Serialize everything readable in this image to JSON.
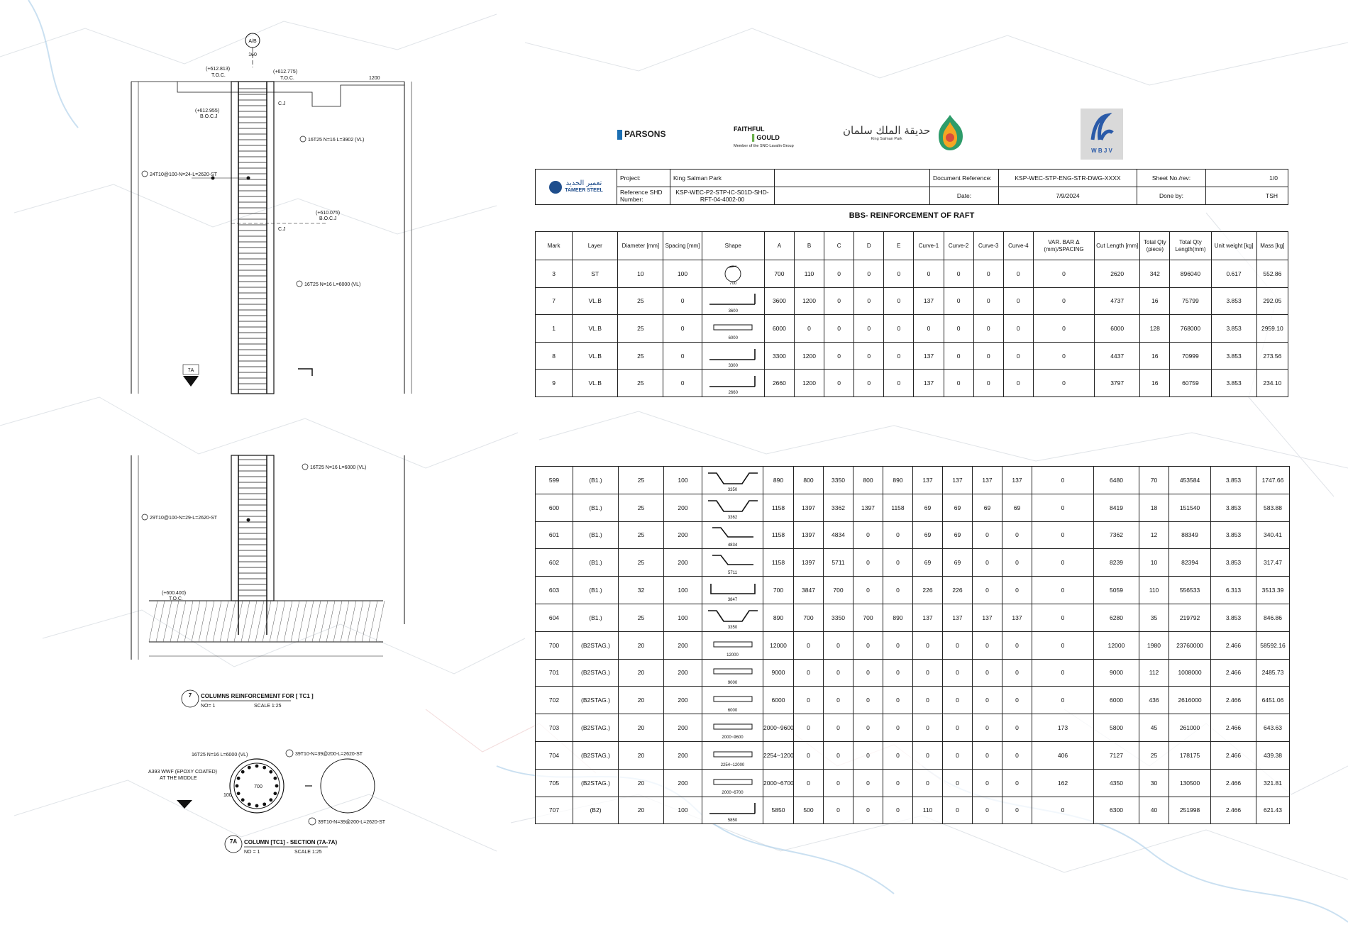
{
  "logos": {
    "parsons": "PARSONS",
    "faithful_line1": "FAITHFUL",
    "faithful_line2": "GOULD",
    "faithful_sub": "Member of the SNC-Lavalin Group",
    "ksp_arabic": "حديقة الملك سلمان",
    "ksp_sub": "King Salman Park",
    "wbjv": "W B J V",
    "tameer_ar": "تعمير الحديد",
    "tameer_en": "TAMEER STEEL"
  },
  "header": {
    "project_label": "Project:",
    "project_value": "King Salman Park",
    "doc_ref_label": "Document Reference:",
    "doc_ref_value": "KSP-WEC-STP-ENG-STR-DWG-XXXX",
    "sheet_label": "Sheet No./rev:",
    "sheet_value": "1/0",
    "ref_shd_label": "Reference SHD Number:",
    "ref_shd_value": "KSP-WEC-P2-STP-IC-S01D-SHD-RFT-04-4002-00",
    "date_label": "Date:",
    "date_value": "7/9/2024",
    "done_label": "Done by:",
    "done_value": "TSH"
  },
  "title": "BBS- REINFORCEMENT OF RAFT",
  "columns": [
    "Mark",
    "Layer",
    "Diameter [mm]",
    "Spacing [mm]",
    "Shape",
    "A",
    "B",
    "C",
    "D",
    "E",
    "Curve-1",
    "Curve-2",
    "Curve-3",
    "Curve-4",
    "VAR. BAR Δ (mm)/SPACING",
    "Cut Length [mm]",
    "Total Qty (piece)",
    "Total Qty Length(mm)",
    "Unit weight [kg]",
    "Mass [kg]"
  ],
  "rows_top": [
    {
      "mark": "3",
      "layer": "ST",
      "dia": "10",
      "sp": "100",
      "shape": "circle",
      "shape_text": "700",
      "A": "700",
      "B": "110",
      "C": "0",
      "D": "0",
      "E": "0",
      "c1": "0",
      "c2": "0",
      "c3": "0",
      "c4": "0",
      "var": "0",
      "cut": "2620",
      "qty": "342",
      "len": "896040",
      "uw": "0.617",
      "mass": "552.86"
    },
    {
      "mark": "7",
      "layer": "VL.B",
      "dia": "25",
      "sp": "0",
      "shape": "L",
      "shape_text": "3600",
      "A": "3600",
      "B": "1200",
      "C": "0",
      "D": "0",
      "E": "0",
      "c1": "137",
      "c2": "0",
      "c3": "0",
      "c4": "0",
      "var": "0",
      "cut": "4737",
      "qty": "16",
      "len": "75799",
      "uw": "3.853",
      "mass": "292.05"
    },
    {
      "mark": "1",
      "layer": "VL.B",
      "dia": "25",
      "sp": "0",
      "shape": "bar",
      "shape_text": "6000",
      "A": "6000",
      "B": "0",
      "C": "0",
      "D": "0",
      "E": "0",
      "c1": "0",
      "c2": "0",
      "c3": "0",
      "c4": "0",
      "var": "0",
      "cut": "6000",
      "qty": "128",
      "len": "768000",
      "uw": "3.853",
      "mass": "2959.10"
    },
    {
      "mark": "8",
      "layer": "VL.B",
      "dia": "25",
      "sp": "0",
      "shape": "L",
      "shape_text": "3300",
      "A": "3300",
      "B": "1200",
      "C": "0",
      "D": "0",
      "E": "0",
      "c1": "137",
      "c2": "0",
      "c3": "0",
      "c4": "0",
      "var": "0",
      "cut": "4437",
      "qty": "16",
      "len": "70999",
      "uw": "3.853",
      "mass": "273.56"
    },
    {
      "mark": "9",
      "layer": "VL.B",
      "dia": "25",
      "sp": "0",
      "shape": "L",
      "shape_text": "2660",
      "A": "2660",
      "B": "1200",
      "C": "0",
      "D": "0",
      "E": "0",
      "c1": "137",
      "c2": "0",
      "c3": "0",
      "c4": "0",
      "var": "0",
      "cut": "3797",
      "qty": "16",
      "len": "60759",
      "uw": "3.853",
      "mass": "234.10"
    }
  ],
  "rows_bottom": [
    {
      "mark": "599",
      "layer": "(B1.)",
      "dia": "25",
      "sp": "100",
      "shape": "crank2",
      "shape_text": "3350",
      "A": "890",
      "B": "800",
      "C": "3350",
      "D": "800",
      "E": "890",
      "c1": "137",
      "c2": "137",
      "c3": "137",
      "c4": "137",
      "var": "0",
      "cut": "6480",
      "qty": "70",
      "len": "453584",
      "uw": "3.853",
      "mass": "1747.66"
    },
    {
      "mark": "600",
      "layer": "(B1.)",
      "dia": "25",
      "sp": "200",
      "shape": "crank2",
      "shape_text": "3362",
      "A": "1158",
      "B": "1397",
      "C": "3362",
      "D": "1397",
      "E": "1158",
      "c1": "69",
      "c2": "69",
      "c3": "69",
      "c4": "69",
      "var": "0",
      "cut": "8419",
      "qty": "18",
      "len": "151540",
      "uw": "3.853",
      "mass": "583.88"
    },
    {
      "mark": "601",
      "layer": "(B1.)",
      "dia": "25",
      "sp": "200",
      "shape": "crank1",
      "shape_text": "4834",
      "A": "1158",
      "B": "1397",
      "C": "4834",
      "D": "0",
      "E": "0",
      "c1": "69",
      "c2": "69",
      "c3": "0",
      "c4": "0",
      "var": "0",
      "cut": "7362",
      "qty": "12",
      "len": "88349",
      "uw": "3.853",
      "mass": "340.41"
    },
    {
      "mark": "602",
      "layer": "(B1.)",
      "dia": "25",
      "sp": "200",
      "shape": "crank1",
      "shape_text": "5711",
      "A": "1158",
      "B": "1397",
      "C": "5711",
      "D": "0",
      "E": "0",
      "c1": "69",
      "c2": "69",
      "c3": "0",
      "c4": "0",
      "var": "0",
      "cut": "8239",
      "qty": "10",
      "len": "82394",
      "uw": "3.853",
      "mass": "317.47"
    },
    {
      "mark": "603",
      "layer": "(B1.)",
      "dia": "32",
      "sp": "100",
      "shape": "U",
      "shape_text": "3847",
      "A": "700",
      "B": "3847",
      "C": "700",
      "D": "0",
      "E": "0",
      "c1": "226",
      "c2": "226",
      "c3": "0",
      "c4": "0",
      "var": "0",
      "cut": "5059",
      "qty": "110",
      "len": "556533",
      "uw": "6.313",
      "mass": "3513.39"
    },
    {
      "mark": "604",
      "layer": "(B1.)",
      "dia": "25",
      "sp": "100",
      "shape": "crank2",
      "shape_text": "3350",
      "A": "890",
      "B": "700",
      "C": "3350",
      "D": "700",
      "E": "890",
      "c1": "137",
      "c2": "137",
      "c3": "137",
      "c4": "137",
      "var": "0",
      "cut": "6280",
      "qty": "35",
      "len": "219792",
      "uw": "3.853",
      "mass": "846.86"
    },
    {
      "mark": "700",
      "layer": "(B2STAG.)",
      "dia": "20",
      "sp": "200",
      "shape": "bar",
      "shape_text": "12000",
      "A": "12000",
      "B": "0",
      "C": "0",
      "D": "0",
      "E": "0",
      "c1": "0",
      "c2": "0",
      "c3": "0",
      "c4": "0",
      "var": "0",
      "cut": "12000",
      "qty": "1980",
      "len": "23760000",
      "uw": "2.466",
      "mass": "58592.16"
    },
    {
      "mark": "701",
      "layer": "(B2STAG.)",
      "dia": "20",
      "sp": "200",
      "shape": "bar",
      "shape_text": "9000",
      "A": "9000",
      "B": "0",
      "C": "0",
      "D": "0",
      "E": "0",
      "c1": "0",
      "c2": "0",
      "c3": "0",
      "c4": "0",
      "var": "0",
      "cut": "9000",
      "qty": "112",
      "len": "1008000",
      "uw": "2.466",
      "mass": "2485.73"
    },
    {
      "mark": "702",
      "layer": "(B2STAG.)",
      "dia": "20",
      "sp": "200",
      "shape": "bar",
      "shape_text": "6000",
      "A": "6000",
      "B": "0",
      "C": "0",
      "D": "0",
      "E": "0",
      "c1": "0",
      "c2": "0",
      "c3": "0",
      "c4": "0",
      "var": "0",
      "cut": "6000",
      "qty": "436",
      "len": "2616000",
      "uw": "2.466",
      "mass": "6451.06"
    },
    {
      "mark": "703",
      "layer": "(B2STAG.)",
      "dia": "20",
      "sp": "200",
      "shape": "bar",
      "shape_text": "2000~9600",
      "A": "2000~9600",
      "B": "0",
      "C": "0",
      "D": "0",
      "E": "0",
      "c1": "0",
      "c2": "0",
      "c3": "0",
      "c4": "0",
      "var": "173",
      "cut": "5800",
      "qty": "45",
      "len": "261000",
      "uw": "2.466",
      "mass": "643.63"
    },
    {
      "mark": "704",
      "layer": "(B2STAG.)",
      "dia": "20",
      "sp": "200",
      "shape": "bar",
      "shape_text": "2254~12000",
      "A": "2254~12000",
      "B": "0",
      "C": "0",
      "D": "0",
      "E": "0",
      "c1": "0",
      "c2": "0",
      "c3": "0",
      "c4": "0",
      "var": "406",
      "cut": "7127",
      "qty": "25",
      "len": "178175",
      "uw": "2.466",
      "mass": "439.38"
    },
    {
      "mark": "705",
      "layer": "(B2STAG.)",
      "dia": "20",
      "sp": "200",
      "shape": "bar",
      "shape_text": "2000~6700",
      "A": "2000~6700",
      "B": "0",
      "C": "0",
      "D": "0",
      "E": "0",
      "c1": "0",
      "c2": "0",
      "c3": "0",
      "c4": "0",
      "var": "162",
      "cut": "4350",
      "qty": "30",
      "len": "130500",
      "uw": "2.466",
      "mass": "321.81"
    },
    {
      "mark": "707",
      "layer": "(B2)",
      "dia": "20",
      "sp": "100",
      "shape": "L",
      "shape_text": "5850",
      "A": "5850",
      "B": "500",
      "C": "0",
      "D": "0",
      "E": "0",
      "c1": "110",
      "c2": "0",
      "c3": "0",
      "c4": "0",
      "var": "0",
      "cut": "6300",
      "qty": "40",
      "len": "251998",
      "uw": "2.466",
      "mass": "621.43"
    }
  ],
  "drawing": {
    "grid_label": "A/B",
    "dim_160": "160",
    "dim_1200": "1200",
    "lvl_1": "(+612.813)",
    "lvl_1_sub": "T.O.C.",
    "lvl_2": "(+612.775)",
    "lvl_2_sub": "T.O.C.",
    "lvl_3": "(+612.955)",
    "lvl_3_sub": "B.O.C.J",
    "lvl_4": "(+610.075)",
    "lvl_4_sub": "B.O.C.J",
    "lvl_5": "(+600.400)",
    "lvl_5_sub": "T.O.C.",
    "cj": "C.J",
    "call_5": "16T25 N=16 L=3902 (VL)",
    "call_1": "16T25 N=16 L=6000 (VL)",
    "call_3a": "24T10@100-N=24-L=2620-ST",
    "call_3b": "29T10@100-N=29-L=2620-ST",
    "call_1b": "16T25 N=16 L=6000 (VL)",
    "sec_mark": "7A",
    "detail_no": "7",
    "detail_title": "COLUMNS REINFORCEMENT FOR [ TC1 ]",
    "detail_no_sub": "NO= 1",
    "detail_scale": "SCALE 1:25",
    "sec_no": "7A",
    "sec_title": "COLUMN [TC1] - SECTION (7A-7A)",
    "sec_no_sub": "NO = 1",
    "sec_scale": "SCALE 1:25",
    "s_call1": "16T25 N=16 L=6000 (VL)",
    "s_call2": "39T10-N=39@200-L=2620-ST",
    "s_call3": "A393 WWF (EPOXY COATED)",
    "s_call3b": "AT THE MIDDLE",
    "s_call4": "39T10-N=39@200-L=2620-ST",
    "s_dim": "700",
    "s_dim2": "100"
  }
}
